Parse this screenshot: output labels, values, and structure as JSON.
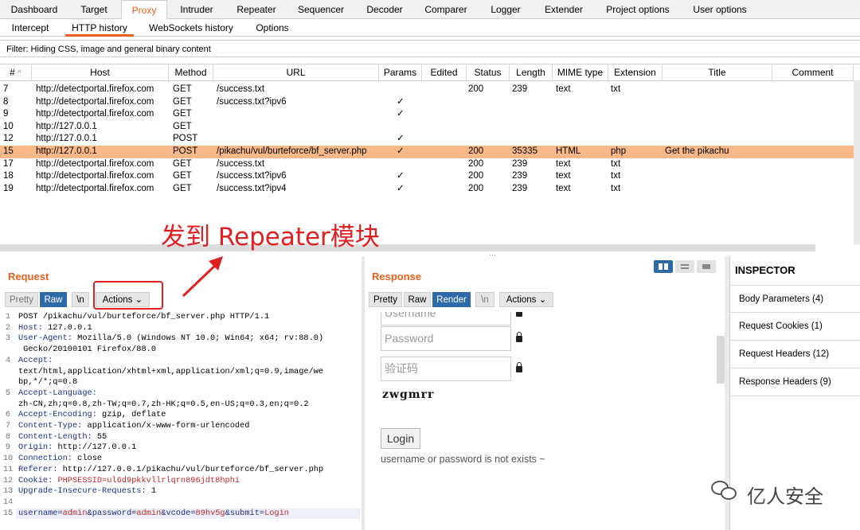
{
  "top_tabs": [
    "Dashboard",
    "Target",
    "Proxy",
    "Intruder",
    "Repeater",
    "Sequencer",
    "Decoder",
    "Comparer",
    "Logger",
    "Extender",
    "Project options",
    "User options"
  ],
  "sub_tabs": [
    "Intercept",
    "HTTP history",
    "WebSockets history",
    "Options"
  ],
  "filter": "Filter: Hiding CSS, image and general binary content",
  "columns": [
    "#",
    "Host",
    "Method",
    "URL",
    "Params",
    "Edited",
    "Status",
    "Length",
    "MIME type",
    "Extension",
    "Title",
    "Comment"
  ],
  "sort_indicator": "^",
  "rows": [
    {
      "num": "7",
      "host": "http://detectportal.firefox.com",
      "method": "GET",
      "url": "/success.txt",
      "params": "",
      "status": "200",
      "length": "239",
      "mime": "text",
      "ext": "txt",
      "title": ""
    },
    {
      "num": "8",
      "host": "http://detectportal.firefox.com",
      "method": "GET",
      "url": "/success.txt?ipv6",
      "params": "✓",
      "status": "",
      "length": "",
      "mime": "",
      "ext": "",
      "title": ""
    },
    {
      "num": "9",
      "host": "http://detectportal.firefox.com",
      "method": "GET",
      "url": "",
      "params": "✓",
      "status": "",
      "length": "",
      "mime": "",
      "ext": "",
      "title": ""
    },
    {
      "num": "10",
      "host": "http://127.0.0.1",
      "method": "GET",
      "url": "",
      "params": "",
      "status": "",
      "length": "",
      "mime": "",
      "ext": "",
      "title": ""
    },
    {
      "num": "12",
      "host": "http://127.0.0.1",
      "method": "POST",
      "url": "",
      "params": "✓",
      "status": "",
      "length": "",
      "mime": "",
      "ext": "",
      "title": ""
    },
    {
      "num": "15",
      "host": "http://127.0.0.1",
      "method": "POST",
      "url": "/pikachu/vul/burteforce/bf_server.php",
      "params": "✓",
      "status": "200",
      "length": "35335",
      "mime": "HTML",
      "ext": "php",
      "title": "Get the pikachu",
      "selected": true
    },
    {
      "num": "17",
      "host": "http://detectportal.firefox.com",
      "method": "GET",
      "url": "/success.txt",
      "params": "",
      "status": "200",
      "length": "239",
      "mime": "text",
      "ext": "txt",
      "title": ""
    },
    {
      "num": "18",
      "host": "http://detectportal.firefox.com",
      "method": "GET",
      "url": "/success.txt?ipv6",
      "params": "✓",
      "status": "200",
      "length": "239",
      "mime": "text",
      "ext": "txt",
      "title": ""
    },
    {
      "num": "19",
      "host": "http://detectportal.firefox.com",
      "method": "GET",
      "url": "/success.txt?ipv4",
      "params": "✓",
      "status": "200",
      "length": "239",
      "mime": "text",
      "ext": "txt",
      "title": ""
    }
  ],
  "annotation": "发到 Repeater模块",
  "request": {
    "title": "Request",
    "buttons": {
      "pretty": "Pretty",
      "raw": "Raw",
      "newline": "\\n",
      "actions": "Actions"
    },
    "lines": [
      {
        "n": "1",
        "k": "",
        "v": "POST /pikachu/vul/burteforce/bf_server.php HTTP/1.1"
      },
      {
        "n": "2",
        "k": "Host:",
        "v": " 127.0.0.1"
      },
      {
        "n": "3",
        "k": "User-Agent:",
        "v": " Mozilla/5.0 (Windows NT 10.0; Win64; x64; rv:88.0)"
      },
      {
        "n": "",
        "k": "",
        "v": " Gecko/20100101 Firefox/88.0"
      },
      {
        "n": "4",
        "k": "Accept:",
        "v": ""
      },
      {
        "n": "",
        "k": "",
        "v": "text/html,application/xhtml+xml,application/xml;q=0.9,image/we"
      },
      {
        "n": "",
        "k": "",
        "v": "bp,*/*;q=0.8"
      },
      {
        "n": "5",
        "k": "Accept-Language:",
        "v": ""
      },
      {
        "n": "",
        "k": "",
        "v": "zh-CN,zh;q=0.8,zh-TW;q=0.7,zh-HK;q=0.5,en-US;q=0.3,en;q=0.2"
      },
      {
        "n": "6",
        "k": "Accept-Encoding:",
        "v": " gzip, deflate"
      },
      {
        "n": "7",
        "k": "Content-Type:",
        "v": " application/x-www-form-urlencoded"
      },
      {
        "n": "8",
        "k": "Content-Length:",
        "v": " 55"
      },
      {
        "n": "9",
        "k": "Origin:",
        "v": " http://127.0.0.1"
      },
      {
        "n": "10",
        "k": "Connection:",
        "v": " close"
      },
      {
        "n": "11",
        "k": "Referer:",
        "v": " http://127.0.0.1/pikachu/vul/burteforce/bf_server.php"
      },
      {
        "n": "12",
        "k": "Cookie:",
        "v": " PHPSESSID=ul6d9pkkvllrlqrn896jdt8hphi"
      },
      {
        "n": "13",
        "k": "Upgrade-Insecure-Requests:",
        "v": " 1"
      },
      {
        "n": "14",
        "k": "",
        "v": ""
      }
    ],
    "body_line": {
      "n": "15",
      "text": "username=admin&password=admin&vcode=89hv5g&submit=Login"
    }
  },
  "response": {
    "title": "Response",
    "buttons": {
      "pretty": "Pretty",
      "raw": "Raw",
      "render": "Render",
      "newline": "\\n",
      "actions": "Actions"
    },
    "username_placeholder": "Username",
    "password_placeholder": "Password",
    "vcode_placeholder": "验证码",
    "captcha": "zwgmrr",
    "login_button": "Login",
    "message": "username or password is not exists ~"
  },
  "inspector": {
    "title": "INSPECTOR",
    "items": [
      "Body Parameters (4)",
      "Request Cookies (1)",
      "Request Headers (12)",
      "Response Headers (9)"
    ]
  },
  "watermark": "亿人安全",
  "colors": {
    "accent": "#e8601d",
    "selected_row": "#f8b887",
    "button_active": "#2e6aa8",
    "annotation": "#e02020"
  }
}
